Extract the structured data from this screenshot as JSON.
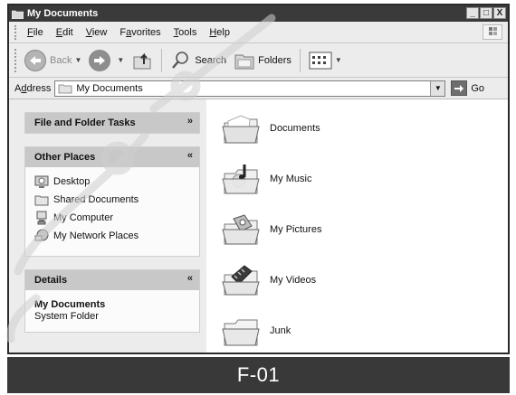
{
  "window": {
    "title": "My Documents",
    "controls": {
      "minimize": "_",
      "maximize": "□",
      "close": "X"
    }
  },
  "menubar": {
    "items": [
      {
        "key": "F",
        "rest": "ile"
      },
      {
        "key": "E",
        "rest": "dit"
      },
      {
        "key": "V",
        "rest": "iew"
      },
      {
        "pre": "F",
        "key": "a",
        "rest": "vorites"
      },
      {
        "key": "T",
        "rest": "ools"
      },
      {
        "key": "H",
        "rest": "elp"
      }
    ]
  },
  "toolbar": {
    "back_label": "Back",
    "search_label": "Search",
    "folders_label": "Folders"
  },
  "addressbar": {
    "label_key": "d",
    "label_pre": "A",
    "label_rest": "dress",
    "value": "My Documents",
    "go_label": "Go"
  },
  "taskpane": {
    "file_tasks_title": "File and Folder Tasks",
    "other_places_title": "Other Places",
    "other_places": [
      {
        "label": "Desktop",
        "icon": "desktop-icon"
      },
      {
        "label": "Shared Documents",
        "icon": "shared-folder-icon"
      },
      {
        "label": "My Computer",
        "icon": "computer-icon"
      },
      {
        "label": "My Network Places",
        "icon": "network-places-icon"
      }
    ],
    "details_title": "Details",
    "details_name": "My Documents",
    "details_type": "System Folder"
  },
  "folders": [
    {
      "name": "Documents",
      "icon": "folder-icon"
    },
    {
      "name": "My Music",
      "icon": "music-folder-icon"
    },
    {
      "name": "My Pictures",
      "icon": "pictures-folder-icon"
    },
    {
      "name": "My Videos",
      "icon": "videos-folder-icon"
    },
    {
      "name": "Junk",
      "icon": "folder-icon"
    }
  ],
  "caption": "F-01",
  "colors": {
    "titlebar": "#3a3a3a",
    "panel_header": "#c8c8c8",
    "caption_bg": "#393939"
  }
}
